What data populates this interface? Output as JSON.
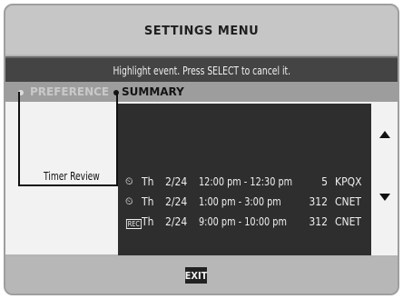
{
  "header": {
    "title": "SETTINGS MENU"
  },
  "message": {
    "text": "Highlight event. Press SELECT to cancel it."
  },
  "breadcrumb": {
    "items": [
      {
        "label": "PREFERENCE"
      },
      {
        "label": "SUMMARY"
      }
    ]
  },
  "section": {
    "label": "Timer Review"
  },
  "timers": [
    {
      "type_icon": "clock-icon",
      "icon_glyph": "⏲",
      "day": "Th",
      "date": "2/24",
      "time": "12:00 pm - 12:30 pm",
      "channel": "5",
      "callsign": "KPQX"
    },
    {
      "type_icon": "clock-icon",
      "icon_glyph": "⏲",
      "day": "Th",
      "date": "2/24",
      "time": "1:00 pm -  3:00 pm",
      "channel": "312",
      "callsign": "CNET"
    },
    {
      "type_icon": "rec-icon",
      "icon_glyph": "REC",
      "day": "Th",
      "date": "2/24",
      "time": "9:00 pm - 10:00 pm",
      "channel": "312",
      "callsign": "CNET"
    }
  ],
  "footer": {
    "exit_label": "EXIT"
  },
  "icons": {
    "scroll_up": "triangle-up-icon",
    "scroll_down": "triangle-down-icon"
  },
  "colors": {
    "panel_dark": "#2e2e2e",
    "message_bar": "#444444",
    "accent_text": "#f0f0f0"
  }
}
